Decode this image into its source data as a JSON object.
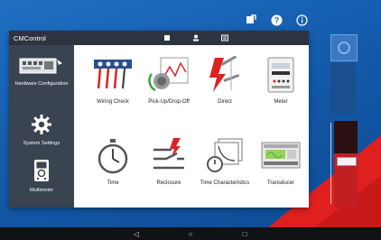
{
  "topbar": {
    "icons": [
      "export-icon",
      "help-icon",
      "info-icon"
    ]
  },
  "app": {
    "title": "CMControl",
    "header_tabs": [
      "home-icon",
      "user-icon",
      "list-icon"
    ]
  },
  "sidebar": {
    "items": [
      {
        "label": "Hardware Configuration",
        "icon": "hardware-icon"
      },
      {
        "label": "System Settings",
        "icon": "gear-icon"
      },
      {
        "label": "Multimeter",
        "icon": "multimeter-icon"
      }
    ]
  },
  "tiles": [
    {
      "label": "Wiring Check",
      "icon": "wiring-check-icon"
    },
    {
      "label": "Pick-Up/Drop-Off",
      "icon": "pickup-dropoff-icon"
    },
    {
      "label": "Direct",
      "icon": "direct-icon"
    },
    {
      "label": "Meter",
      "icon": "meter-icon"
    },
    {
      "label": "Time",
      "icon": "stopwatch-icon"
    },
    {
      "label": "Reclosure",
      "icon": "reclosure-icon"
    },
    {
      "label": "Time Characteristics",
      "icon": "time-characteristics-icon"
    },
    {
      "label": "Transducer",
      "icon": "transducer-icon"
    }
  ],
  "side_panel": {
    "colors": {
      "accent_red": "#d42a2a",
      "panel_dark": "#1d3550"
    }
  },
  "navbar": {
    "buttons": [
      "back-icon",
      "home-circle-icon",
      "recents-icon"
    ]
  },
  "colors": {
    "background_blue": "#1565c0",
    "red": "#e02020",
    "header_dark": "#2d3440",
    "sidebar": "#3a4350"
  }
}
